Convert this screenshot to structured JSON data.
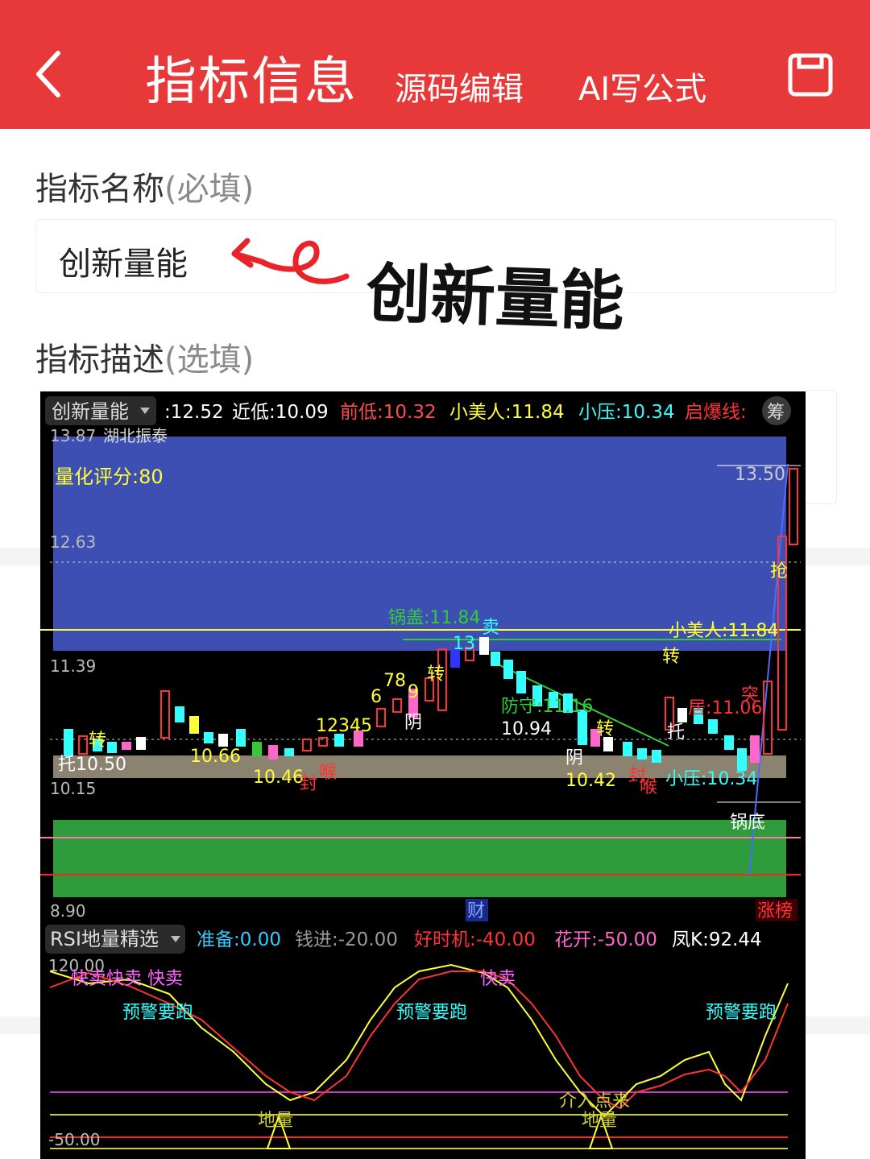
{
  "header": {
    "title": "指标信息",
    "source_edit": "源码编辑",
    "ai_formula": "AI写公式",
    "back_icon": "chevron-left-icon",
    "save_icon": "save-icon",
    "bg_color": "#e8393a"
  },
  "form": {
    "name_label": "指标名称",
    "name_required": "(必填)",
    "name_value": "创新量能",
    "desc_label": "指标描述",
    "desc_optional": "(选填)"
  },
  "annotation": {
    "text": "创新量能"
  },
  "chart": {
    "indicator_name": "创新量能",
    "header_values": [
      {
        "text": ":12.52",
        "color": "#ffffff"
      },
      {
        "text": "近低:10.09",
        "color": "#ffffff"
      },
      {
        "text": "前低:10.32",
        "color": "#ff4d4d"
      },
      {
        "text": "小美人:11.84",
        "color": "#ffff33"
      },
      {
        "text": "小压:10.34",
        "color": "#33ffff"
      },
      {
        "text": "启爆线:",
        "color": "#ff3333"
      }
    ],
    "chip_btn": "筹",
    "top_label_cut": "13.87",
    "top_label_cut2": "湖北振泰",
    "score": "量化评分:80",
    "y_ticks": [
      "12.63",
      "11.39",
      "10.15",
      "8.90"
    ],
    "price_high": "13.50",
    "labels": {
      "guogai": "锅盖:11.84",
      "sell": "卖",
      "n13": "13",
      "n78": "78",
      "n9": "9",
      "n6": "6",
      "zhuan": "转",
      "xiaomeiren": "小美人:11.84",
      "qiang": "抢",
      "tu": "突",
      "ju": "居:11.06",
      "tuo": "托",
      "tuo_price": "托10.50",
      "p1066": "10.66",
      "p1046": "10.46",
      "feng": "封",
      "hou": "喉",
      "yin": "阴",
      "fangshou": "防守:11.16",
      "p1094": "10.94",
      "p1042": "10.42",
      "xiaoya": "小压:10.34",
      "guodi": "锅底",
      "cai": "财",
      "zhangbang": "涨榜",
      "seq": "12345"
    },
    "sub_indicator": "RSI地量精选",
    "sub_values": [
      {
        "text": "准备:0.00",
        "color": "#33ccff"
      },
      {
        "text": "钱进:-20.00",
        "color": "#999999"
      },
      {
        "text": "好时机:-40.00",
        "color": "#ff3333"
      },
      {
        "text": "花开:-50.00",
        "color": "#ff66cc"
      },
      {
        "text": "凤K:92.44",
        "color": "#ffffff"
      }
    ],
    "sub_ticks": [
      "120.00",
      "-50.00"
    ],
    "sub_labels": {
      "kuaimai": "快卖",
      "kuaimai3": "快卖快卖 快卖",
      "yujing": "预警要跑",
      "diliang": "地量",
      "jiezhu": "介入点来"
    }
  }
}
